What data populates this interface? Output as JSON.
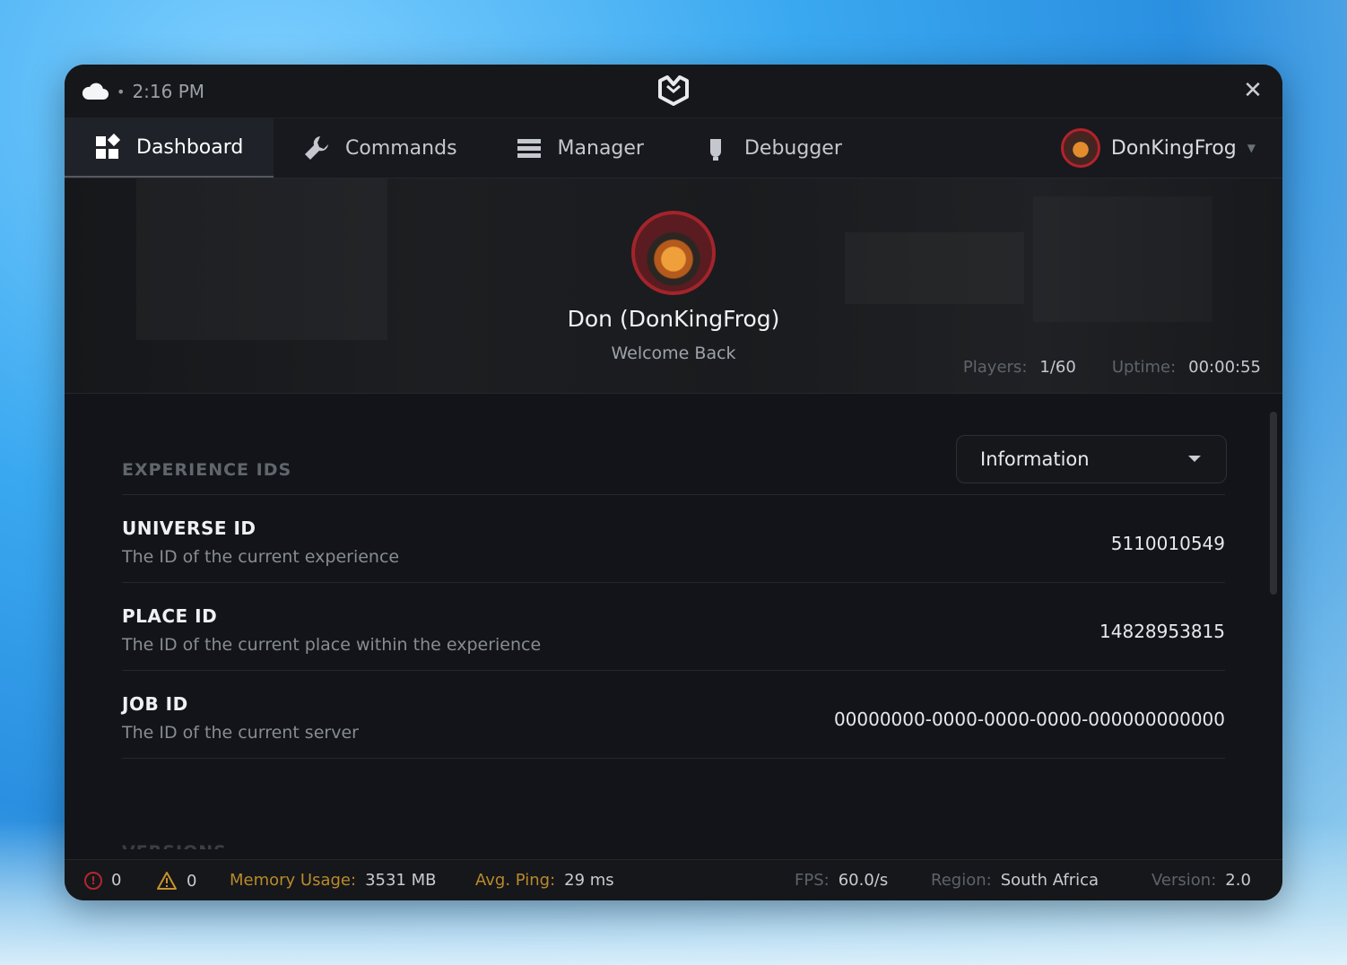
{
  "titlebar": {
    "time": "2:16 PM",
    "close_icon": "close-icon"
  },
  "nav": {
    "items": [
      {
        "label": "Dashboard",
        "icon": "grid-icon"
      },
      {
        "label": "Commands",
        "icon": "wrench-icon"
      },
      {
        "label": "Manager",
        "icon": "list-icon"
      },
      {
        "label": "Debugger",
        "icon": "bug-icon"
      }
    ],
    "user": "DonKingFrog"
  },
  "hero": {
    "name": "Don (DonKingFrog)",
    "welcome": "Welcome Back",
    "players_label": "Players:",
    "players_value": "1/60",
    "uptime_label": "Uptime:",
    "uptime_value": "00:00:55"
  },
  "content": {
    "section_title": "EXPERIENCE IDS",
    "dropdown": "Information",
    "rows": [
      {
        "title": "UNIVERSE ID",
        "desc": "The ID of the current experience",
        "value": "5110010549"
      },
      {
        "title": "PLACE ID",
        "desc": "The ID of the current place within the experience",
        "value": "14828953815"
      },
      {
        "title": "JOB ID",
        "desc": "The ID of the current server",
        "value": "00000000-0000-0000-0000-000000000000"
      }
    ],
    "next_section": "VERSIONS"
  },
  "statusbar": {
    "errors": "0",
    "warnings": "0",
    "memory_label": "Memory Usage:",
    "memory_value": "3531 MB",
    "ping_label": "Avg. Ping:",
    "ping_value": "29 ms",
    "fps_label": "FPS:",
    "fps_value": "60.0/s",
    "region_label": "Region:",
    "region_value": "South Africa",
    "version_label": "Version:",
    "version_value": "2.0"
  },
  "colors": {
    "accent_red": "#b3232b",
    "warning": "#b98a2a",
    "background": "#121418"
  }
}
